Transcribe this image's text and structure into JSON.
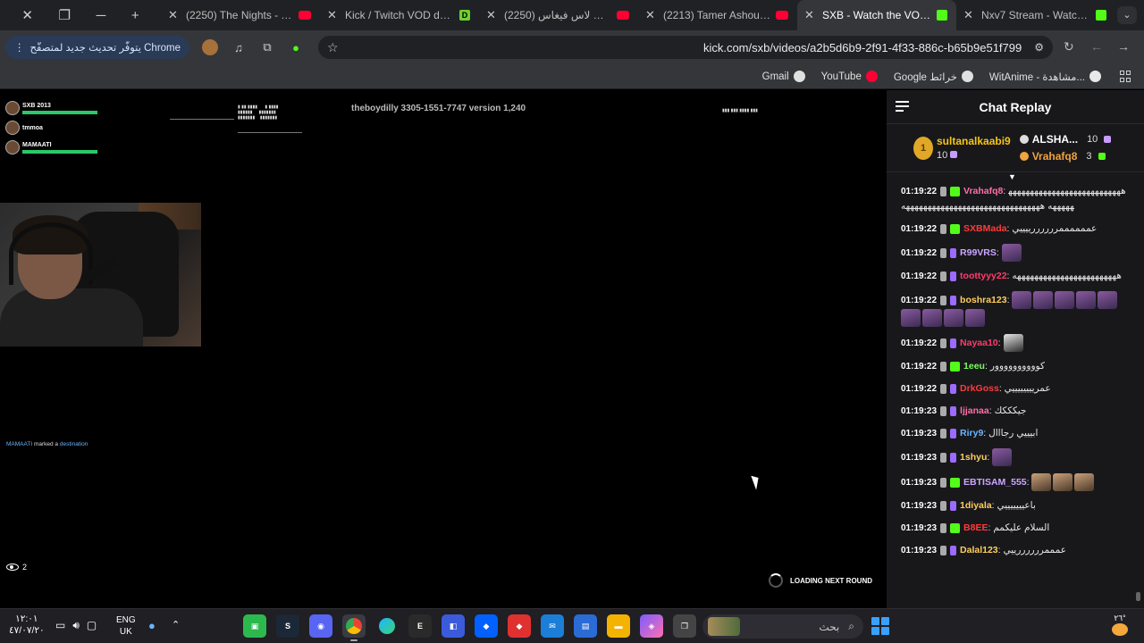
{
  "tabs": [
    {
      "title": "(2250) The Nights - YouTube",
      "fav": "youtube-icon"
    },
    {
      "title": "Kick / Twitch VOD downloader",
      "fav": "d-icon"
    },
    {
      "title": "(2250) شباب باور في لاس فيغاس",
      "fav": "youtube-icon"
    },
    {
      "title": "(2213) Tamer Ashour - Hay",
      "fav": "youtube-icon"
    },
    {
      "title": "SXB - Watch the VOD o",
      "fav": "kick-icon",
      "active": true
    },
    {
      "title": "Nxv7 Stream - Watch Live",
      "fav": "kick-icon"
    }
  ],
  "toolbar": {
    "update_label": "يتوفّر تحديث جديد لمتصفّح Chrome",
    "url": "kick.com/sxb/videos/a2b5d6b9-2f91-4f33-886c-b65b9e51f799"
  },
  "bookmarks": [
    {
      "label": "Gmail",
      "color": "#e0e0e0"
    },
    {
      "label": "YouTube",
      "color": "#ff0033"
    },
    {
      "label": "Google خرائط",
      "color": "#e0e0e0"
    },
    {
      "label": "WitAnime - مشاهدة...",
      "color": "#e8e8e8"
    }
  ],
  "video": {
    "players": [
      {
        "name": "SXB 2013"
      },
      {
        "name": "tmmoa"
      },
      {
        "name": "MAMAATI"
      }
    ],
    "streamer_tag": "theboydilly   3305-1551-7747 version 1,240",
    "marked_user": "MAMAATI",
    "marked_text": "marked a",
    "marked_dest": "destination",
    "viewers": "2",
    "loading": "LOADING NEXT ROUND"
  },
  "chat": {
    "title": "Chat Replay",
    "top_gifter": {
      "rank": "1",
      "name": "sultanalkaabi9",
      "count": "10"
    },
    "gifters": [
      {
        "name": "ALSHA...",
        "count": "10",
        "color": "#ffffff"
      },
      {
        "name": "Vrahafq8",
        "count": "3",
        "color": "#f0a33e"
      }
    ],
    "messages": [
      {
        "time": "01:19:22",
        "user": "Vrahafq8",
        "color": "#ff6fa5",
        "badge": "gift",
        "text": "ههههههههههههههههههههههههههههههههه ههههههههههههههههههههههههههههههههه"
      },
      {
        "time": "01:19:22",
        "user": "SXBMada",
        "color": "#ff3b3b",
        "badge": "gift",
        "text": "عممممممررررررييييي"
      },
      {
        "time": "01:19:22",
        "user": "R99VRS",
        "color": "#cda6ff",
        "badge": "sub",
        "text": "",
        "emotes": 1
      },
      {
        "time": "01:19:22",
        "user": "toottyyy22",
        "color": "#ff3b6b",
        "badge": "sub",
        "text": "ههههههههههههههههههههههههه"
      },
      {
        "time": "01:19:22",
        "user": "boshra123",
        "color": "#ffcf5c",
        "badge": "sub",
        "text": "",
        "emotes": 9
      },
      {
        "time": "01:19:22",
        "user": "Nayaa10",
        "color": "#ff3b6b",
        "badge": "sub",
        "text": "",
        "emotes": 1,
        "emote_style": "w"
      },
      {
        "time": "01:19:22",
        "user": "1eeu",
        "color": "#79ff5c",
        "badge": "gift",
        "text": "كوووووووووور"
      },
      {
        "time": "01:19:22",
        "user": "DrkGoss",
        "color": "#ff3b3b",
        "badge": "sub",
        "text": "عمرييييييييي"
      },
      {
        "time": "01:19:23",
        "user": "ljjanaa",
        "color": "#ff6fa5",
        "badge": "sub",
        "text": "جيكككك"
      },
      {
        "time": "01:19:23",
        "user": "Riry9",
        "color": "#6ab4ff",
        "badge": "sub",
        "text": "ابيييي رجااال"
      },
      {
        "time": "01:19:23",
        "user": "1shyu",
        "color": "#ffcf5c",
        "badge": "sub",
        "text": "",
        "emotes": 1
      },
      {
        "time": "01:19:23",
        "user": "EBTISAM_555",
        "color": "#cda6ff",
        "badge": "gift",
        "text": "",
        "emotes": 3,
        "emote_style": "c"
      },
      {
        "time": "01:19:23",
        "user": "1diyala",
        "color": "#ffcf5c",
        "badge": "sub",
        "text": "باعيييييييي"
      },
      {
        "time": "01:19:23",
        "user": "B8EE",
        "color": "#ff3b3b",
        "badge": "gift",
        "text": "السلام عليكمم"
      },
      {
        "time": "01:19:23",
        "user": "Dalal123",
        "color": "#ffcf5c",
        "badge": "sub",
        "text": "عمممررررررييي"
      }
    ]
  },
  "taskbar": {
    "time": "١٢:٠١",
    "date": "٤٧/٠٧/٢٠",
    "lang1": "ENG",
    "lang2": "UK",
    "search_placeholder": "بحث",
    "weather_temp": "٢٦°"
  }
}
